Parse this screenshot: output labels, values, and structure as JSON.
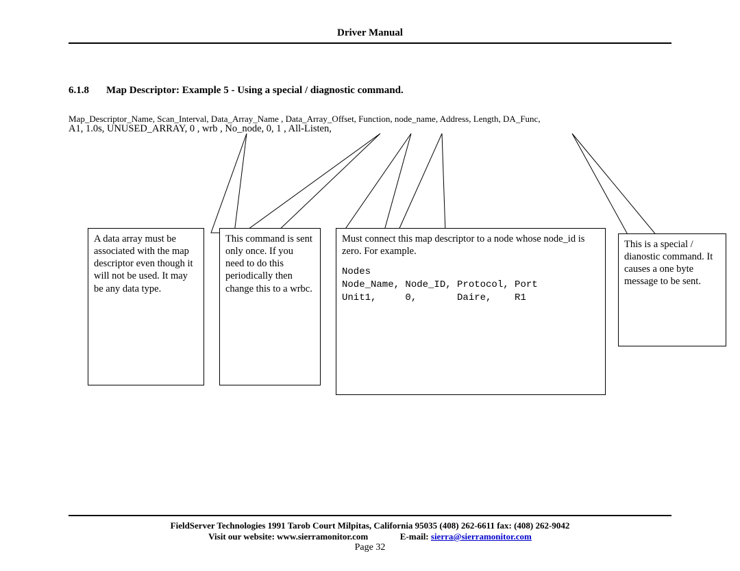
{
  "header": {
    "title": "Driver Manual"
  },
  "section": {
    "num": "6.1.8",
    "title": "Map Descriptor: Example 5 - Using a special / diagnostic command."
  },
  "table": {
    "headers": "Map_Descriptor_Name, Scan_Interval, Data_Array_Name      , Data_Array_Offset,  Function,    node_name, Address, Length,  DA_Func,",
    "values": "A1,                           1.0s,          UNUSED_ARRAY,       0                  , wrb      ,  No_node, 0,         1 ,      All-Listen,"
  },
  "callouts": {
    "data_array": "A data array must be associated with the map descriptor even though it will not be used. It may be any data type.",
    "this_command": "This command is sent only once. If you need to do this periodically then change this to a wrbc.",
    "must_connect_intro": "Must connect this map descriptor to a node whose node_id is zero. For example.",
    "nodes_block": "Nodes\nNode_Name, Node_ID, Protocol, Port\nUnit1,     0,       Daire,    R1",
    "special": "This is a special / dianostic command. It causes a one byte message to be sent."
  },
  "footer": {
    "line1": "FieldServer Technologies 1991 Tarob Court Milpitas, California 95035 (408) 262-6611 fax: (408) 262-9042",
    "line2a": "Visit our website: www.sierramonitor.com",
    "line2b": "E-mail: ",
    "email": "sierra@sierramonitor.com",
    "page": "Page 32"
  }
}
